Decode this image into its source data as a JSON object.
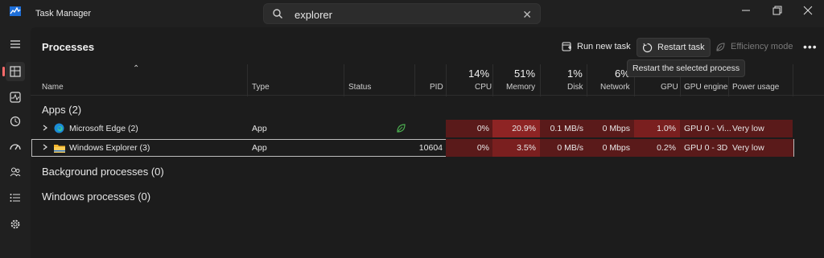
{
  "window": {
    "title": "Task Manager"
  },
  "search": {
    "value": "explorer"
  },
  "toolbar": {
    "page_title": "Processes",
    "run_new_task": "Run new task",
    "restart_task": "Restart task",
    "efficiency_mode": "Efficiency mode",
    "tooltip": "Restart the selected process"
  },
  "columns": {
    "name": "Name",
    "type": "Type",
    "status": "Status",
    "pid": "PID",
    "cpu": "CPU",
    "memory": "Memory",
    "disk": "Disk",
    "network": "Network",
    "gpu": "GPU",
    "gpu_engine": "GPU engine",
    "power_usage": "Power usage"
  },
  "usage": {
    "cpu": "14%",
    "memory": "51%",
    "disk": "1%",
    "network": "6%"
  },
  "sections": {
    "apps": "Apps (2)",
    "background": "Background processes (0)",
    "windows": "Windows processes (0)"
  },
  "rows": [
    {
      "name": "Microsoft Edge (2)",
      "type": "App",
      "pid": "",
      "cpu": "0%",
      "memory": "20.9%",
      "disk": "0.1 MB/s",
      "network": "0 Mbps",
      "gpu": "1.0%",
      "gpu_engine": "GPU 0 - Vi...",
      "power_usage": "Very low"
    },
    {
      "name": "Windows Explorer (3)",
      "type": "App",
      "pid": "10604",
      "cpu": "0%",
      "memory": "3.5%",
      "disk": "0 MB/s",
      "network": "0 Mbps",
      "gpu": "0.2%",
      "gpu_engine": "GPU 0 - 3D",
      "power_usage": "Very low"
    }
  ],
  "colors": {
    "heat_light": "#5a1a1a",
    "heat_mid": "#7a1f1f",
    "heat_strong": "#8e2424",
    "accent": "#ff6b6b"
  },
  "icons": [
    "task-manager-icon",
    "search-icon",
    "close-icon",
    "minimize-icon",
    "maximize-icon",
    "hamburger-icon",
    "processes-icon",
    "performance-icon",
    "app-history-icon",
    "startup-apps-icon",
    "users-icon",
    "details-icon",
    "services-icon",
    "run-new-task-icon",
    "restart-icon",
    "efficiency-leaf-icon",
    "more-icon",
    "edge-icon",
    "folder-icon"
  ]
}
